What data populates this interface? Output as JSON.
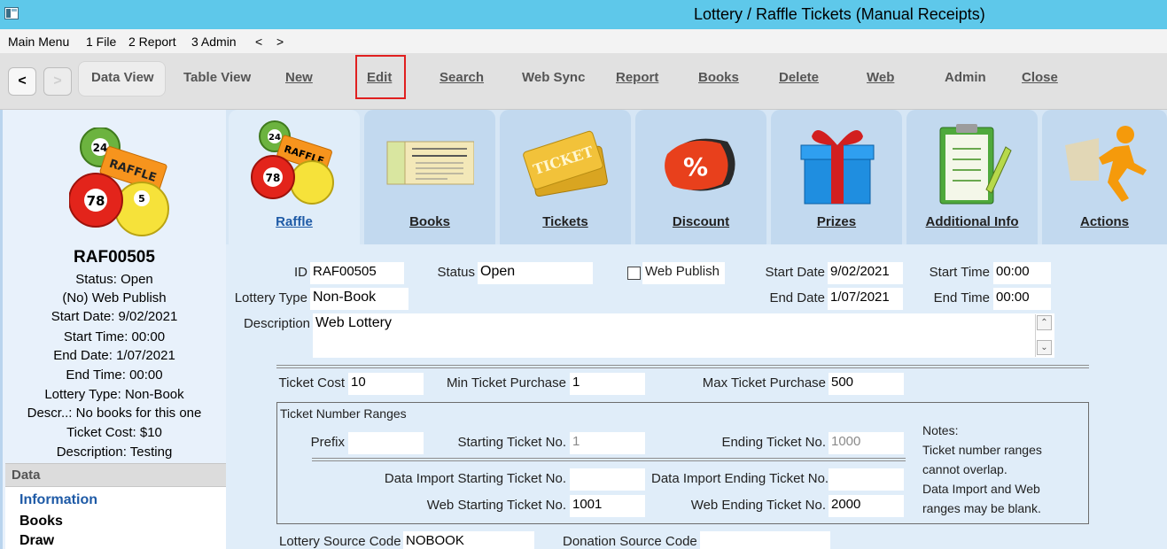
{
  "window": {
    "title": "Lottery / Raffle Tickets (Manual Receipts)"
  },
  "menu": [
    "Main Menu",
    "1 File",
    "2 Report",
    "3 Admin",
    "<",
    ">"
  ],
  "toolbar": {
    "back": "<",
    "forward": ">",
    "buttons": [
      "Data View",
      "Table View",
      "New",
      "Edit",
      "Search",
      "Web Sync",
      "Report",
      "Books",
      "Delete",
      "Web",
      "Admin",
      "Close"
    ]
  },
  "sidebar": {
    "code": "RAF00505",
    "lines": [
      "Status: Open",
      "(No) Web Publish",
      "Start Date: 9/02/2021",
      "Start Time: 00:00",
      "End Date: 1/07/2021",
      "End Time: 00:00",
      "Lottery Type: Non-Book",
      "Descr..: No books for this one",
      "Ticket Cost: $10",
      "Description: Testing"
    ],
    "data_header": "Data",
    "data_items": [
      "Information",
      "Books",
      "Draw"
    ]
  },
  "tabs": [
    "Raffle",
    "Books",
    "Tickets",
    "Discount",
    "Prizes",
    "Additional Info",
    "Actions"
  ],
  "form": {
    "id_label": "ID",
    "id_value": "RAF00505",
    "status_label": "Status",
    "status_value": "Open",
    "web_publish_label": "Web Publish",
    "web_publish_checked": false,
    "start_date_label": "Start Date",
    "start_date_value": "9/02/2021",
    "start_time_label": "Start Time",
    "start_time_value": "00:00",
    "lottery_type_label": "Lottery Type",
    "lottery_type_value": "Non-Book",
    "end_date_label": "End Date",
    "end_date_value": "1/07/2021",
    "end_time_label": "End Time",
    "end_time_value": "00:00",
    "description_label": "Description",
    "description_value": "Web Lottery",
    "ticket_cost_label": "Ticket Cost",
    "ticket_cost_value": "10",
    "min_purchase_label": "Min Ticket Purchase",
    "min_purchase_value": "1",
    "max_purchase_label": "Max Ticket Purchase",
    "max_purchase_value": "500",
    "ranges_title": "Ticket Number Ranges",
    "prefix_label": "Prefix",
    "prefix_value": "",
    "start_no_label": "Starting Ticket No.",
    "start_no_value": "1",
    "end_no_label": "Ending Ticket No.",
    "end_no_value": "1000",
    "import_start_label": "Data Import Starting Ticket No.",
    "import_start_value": "",
    "import_end_label": "Data Import Ending Ticket No.",
    "import_end_value": "",
    "web_start_label": "Web Starting Ticket No.",
    "web_start_value": "1001",
    "web_end_label": "Web Ending Ticket No.",
    "web_end_value": "2000",
    "notes": [
      "Notes:",
      "Ticket number ranges",
      "cannot overlap.",
      "Data Import and Web",
      "ranges may be blank."
    ],
    "source_code_label": "Lottery Source Code",
    "source_code_value": "NOBOOK",
    "donation_code_label": "Donation Source Code",
    "donation_code_value": ""
  },
  "icons": {
    "raffle": "raffle-balls-icon",
    "books": "ticket-book-icon",
    "tickets": "tickets-icon",
    "discount": "discount-tag-icon",
    "prizes": "gift-box-icon",
    "additional": "clipboard-icon",
    "actions": "running-man-icon"
  },
  "colors": {
    "titlebar": "#5ec8ea",
    "active_tab_label": "#1e5aa6",
    "highlight": "#e02020"
  }
}
